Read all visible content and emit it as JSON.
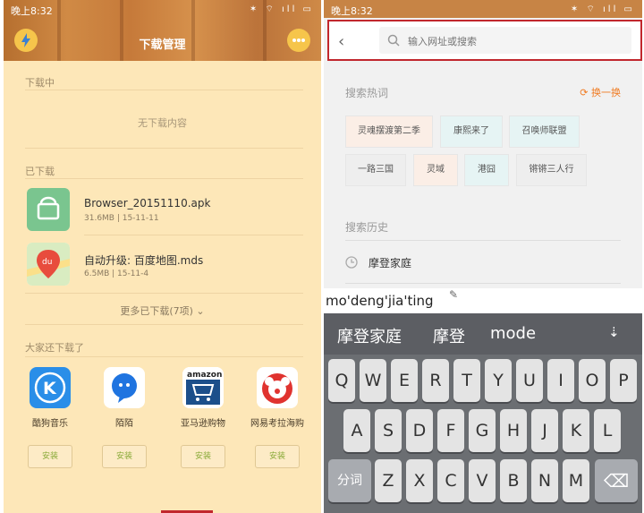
{
  "left": {
    "status_time": "晚上8:32",
    "status_icons": "✶ ⌔ ıll ▭",
    "title": "下载管理",
    "downloading": {
      "header": "下载中",
      "empty": "无下载内容"
    },
    "downloaded": {
      "header": "已下载",
      "items": [
        {
          "name": "Browser_20151110.apk",
          "meta": "31.6MB | 15-11-11",
          "icon": "android-apk-icon"
        },
        {
          "name": "自动升级: 百度地图.mds",
          "meta": "6.5MB | 15-11-4",
          "icon": "baidu-map-icon"
        }
      ],
      "more": "更多已下载(7项) ⌄"
    },
    "recommend": {
      "header": "大家还下载了",
      "apps": [
        {
          "name": "酷狗音乐",
          "install": "安装",
          "color": "#2a8ee8"
        },
        {
          "name": "陌陌",
          "install": "安装",
          "color": "#1f74e0"
        },
        {
          "name": "亚马逊购物",
          "install": "安装",
          "color": "#1c4f8a"
        },
        {
          "name": "网易考拉海购",
          "install": "安装",
          "color": "#e0332f"
        }
      ]
    }
  },
  "right": {
    "status_time": "晚上8:32",
    "search_placeholder": "输入网址或搜索",
    "hot": {
      "header": "搜索热词",
      "refresh": "换一换",
      "words": [
        "灵魂摆渡第二季",
        "康熙来了",
        "召唤师联盟",
        "一路三国",
        "灵域",
        "港囧",
        "锵锵三人行"
      ]
    },
    "history": {
      "header": "搜索历史",
      "items": [
        "摩登家庭"
      ]
    },
    "ime": {
      "pinyin": "mo'deng'jia'ting",
      "candidates": [
        "摩登家庭",
        "摩登",
        "mode"
      ],
      "row1": [
        "Q",
        "W",
        "E",
        "R",
        "T",
        "Y",
        "U",
        "I",
        "O",
        "P"
      ],
      "row2": [
        "A",
        "S",
        "D",
        "F",
        "G",
        "H",
        "J",
        "K",
        "L"
      ],
      "row3": [
        "Z",
        "X",
        "C",
        "V",
        "B",
        "N",
        "M"
      ],
      "fn_key": "分词",
      "delete_key": "⌫",
      "collapse_key": "⇣"
    }
  }
}
